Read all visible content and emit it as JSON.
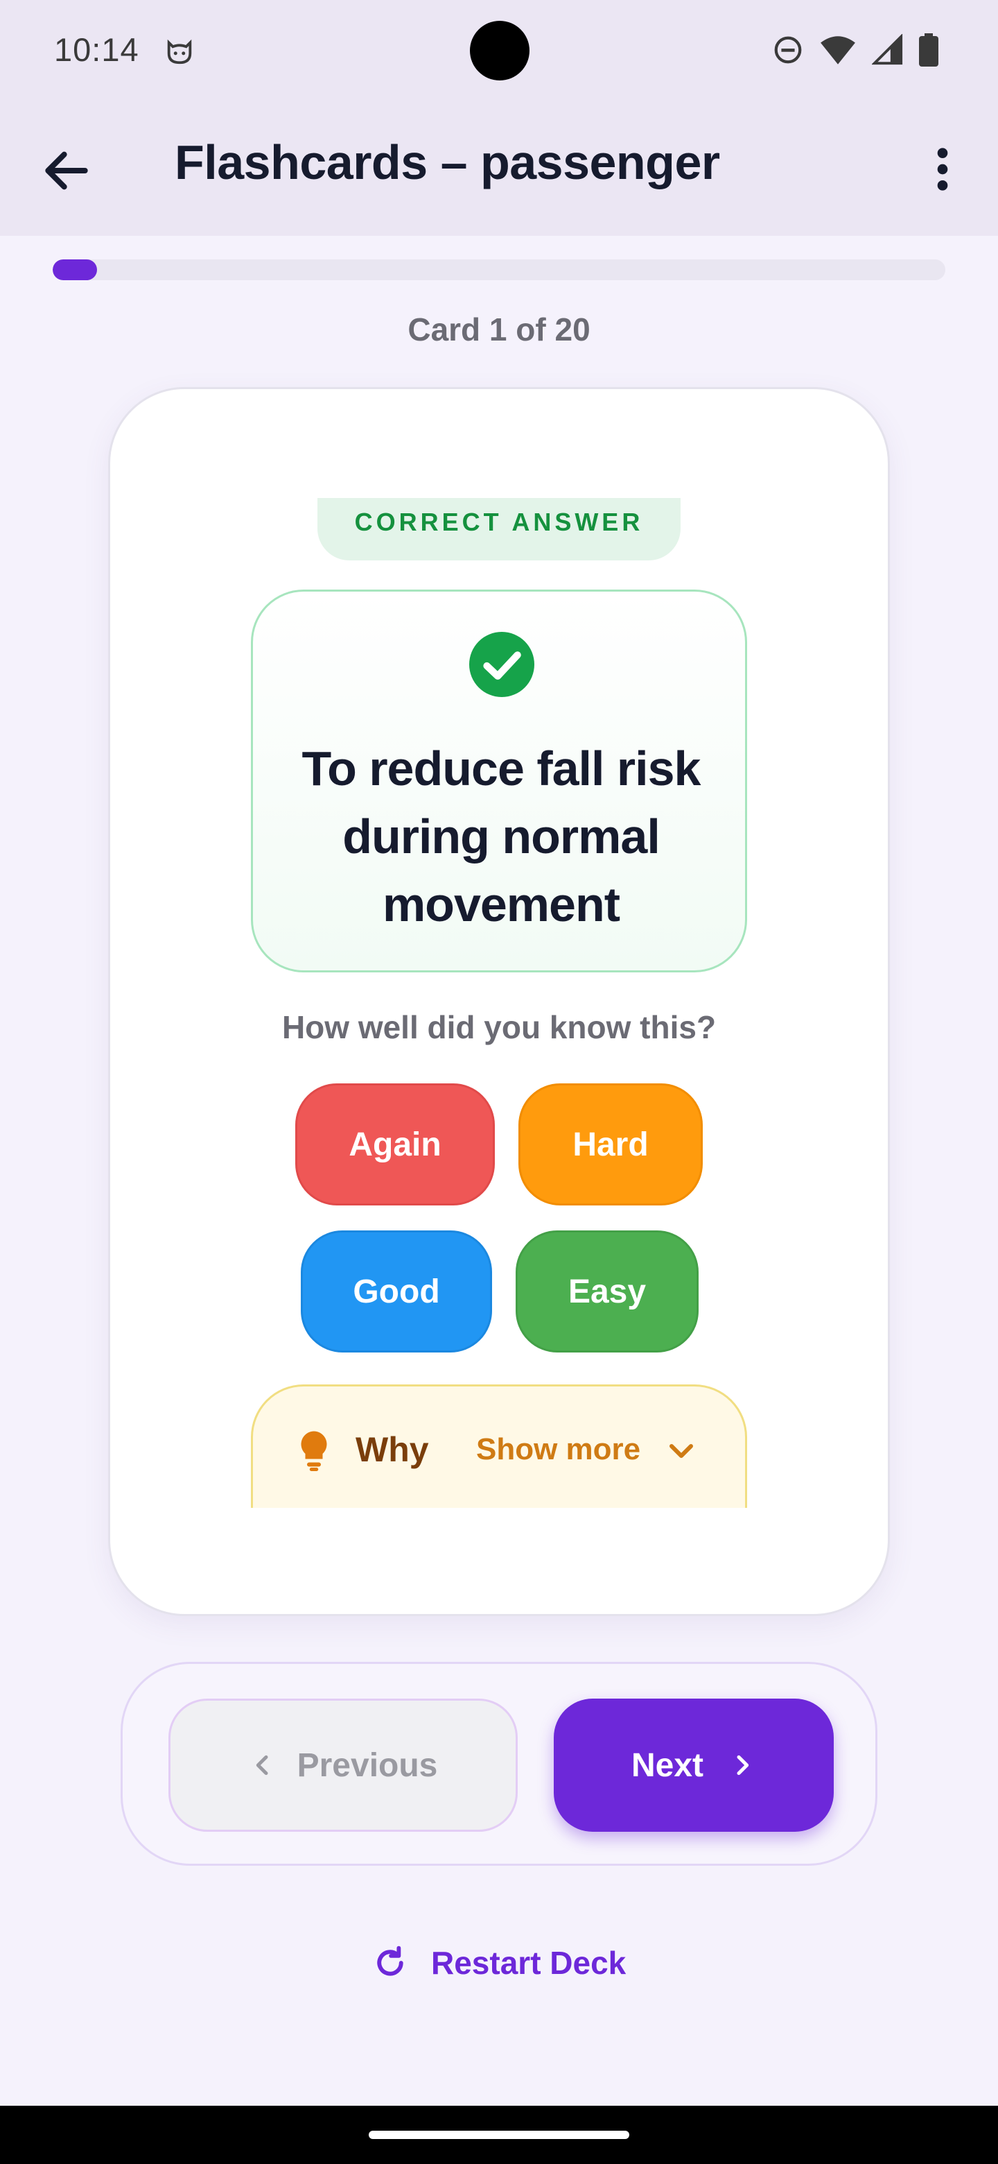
{
  "status_bar": {
    "time": "10:14",
    "icons": [
      "cat-notification-icon",
      "do-not-disturb-icon",
      "wifi-icon",
      "cellular-signal-icon",
      "battery-icon"
    ]
  },
  "app_bar": {
    "title": "Flashcards – passenger",
    "back_icon": "arrow-left-icon",
    "menu_icon": "more-vertical-icon"
  },
  "progress": {
    "current": 1,
    "total": 20,
    "fraction": 0.05,
    "label": "Card 1 of 20"
  },
  "card": {
    "badge": "CORRECT ANSWER",
    "answer": "To reduce fall risk during normal movement",
    "rating_prompt": "How well did you know this?",
    "ratings": {
      "again": "Again",
      "hard": "Hard",
      "good": "Good",
      "easy": "Easy"
    },
    "why": {
      "label": "Why",
      "toggle": "Show more"
    }
  },
  "navigation": {
    "previous": "Previous",
    "next": "Next",
    "restart": "Restart Deck"
  },
  "colors": {
    "accent": "#6d28d9",
    "again": "#ef5756",
    "hard": "#ff9b0d",
    "good": "#2196f3",
    "easy": "#4caf50",
    "correct": "#15913e",
    "why_text": "#7a3e0b"
  }
}
